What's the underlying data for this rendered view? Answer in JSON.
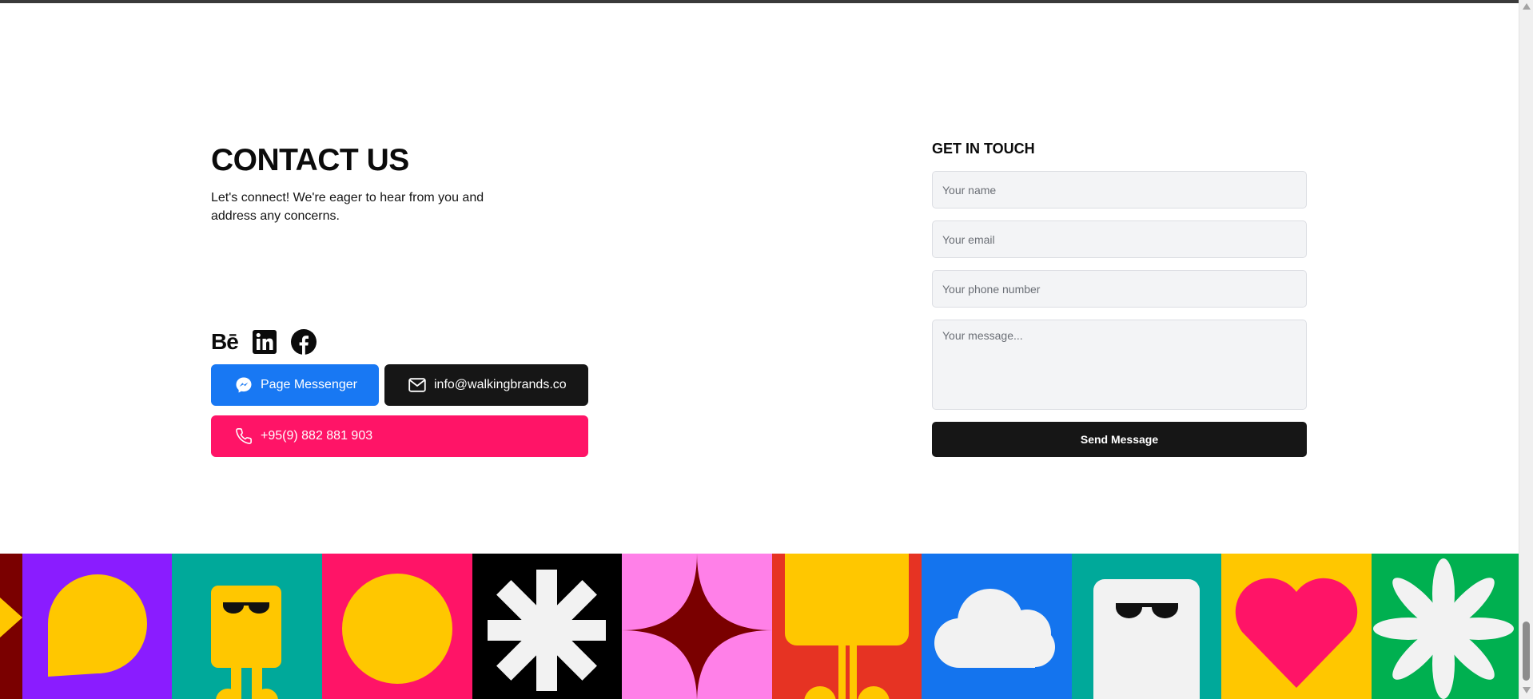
{
  "contact": {
    "title": "CONTACT US",
    "description": "Let's connect! We're eager to hear from you and address any concerns."
  },
  "social": {
    "behance": "Bē",
    "icons": [
      "behance-icon",
      "linkedin-icon",
      "facebook-icon"
    ]
  },
  "buttons": {
    "messenger": "Page Messenger",
    "email": "info@walkingbrands.co",
    "phone": "+95(9) 882 881 903"
  },
  "form": {
    "title": "GET IN TOUCH",
    "name_placeholder": "Your name",
    "email_placeholder": "Your email",
    "phone_placeholder": "Your phone number",
    "message_placeholder": "Your message...",
    "submit": "Send Message"
  },
  "colors": {
    "messenger": "#1878f3",
    "email": "#161616",
    "phone": "#ff1467",
    "submit": "#161616",
    "field_bg": "#f3f4f6"
  },
  "tiles": [
    {
      "name": "triangle-tile",
      "bg": "#7a0000",
      "fg": "#ffc700"
    },
    {
      "name": "speech-bubble-tile",
      "bg": "#8a1cff",
      "fg": "#ffc700"
    },
    {
      "name": "robot-sunglasses-tile",
      "bg": "#00a99a",
      "fg": "#ffc700"
    },
    {
      "name": "circle-tile",
      "bg": "#ff1467",
      "fg": "#ffc700"
    },
    {
      "name": "asterisk-tile",
      "bg": "#000000",
      "fg": "#f2f2f2"
    },
    {
      "name": "four-point-star-tile",
      "bg": "#ff80e8",
      "fg": "#7a0000"
    },
    {
      "name": "figure-tile",
      "bg": "#e63323",
      "fg": "#ffc700"
    },
    {
      "name": "cloud-tile",
      "bg": "#1474ee",
      "fg": "#f2f2f2"
    },
    {
      "name": "ghost-sunglasses-tile",
      "bg": "#00a99a",
      "fg": "#f2f2f2"
    },
    {
      "name": "heart-tile",
      "bg": "#ffc700",
      "fg": "#ff1467"
    },
    {
      "name": "flower-tile",
      "bg": "#00b050",
      "fg": "#f2f2f2"
    }
  ]
}
